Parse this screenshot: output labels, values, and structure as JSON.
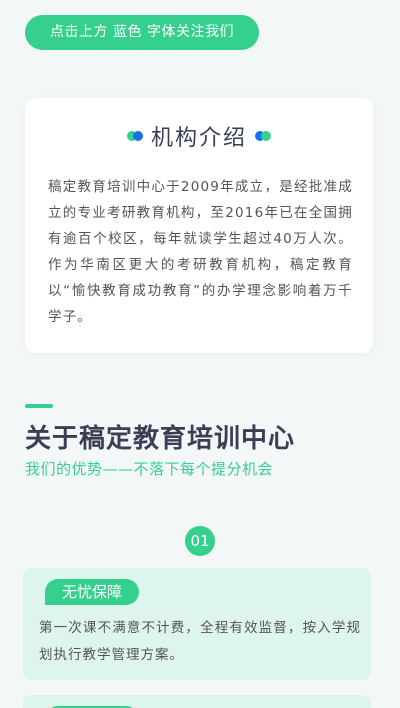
{
  "banner": {
    "follow_text": "点击上方 蓝色 字体关注我们"
  },
  "intro": {
    "title": "机构介绍",
    "body": "稿定教育培训中心于2009年成立，是经批准成立的专业考研教育机构，至2016年已在全国拥有逾百个校区，每年就读学生超过40万人次。作为华南区更大的考研教育机构，稿定教育以“愉快教育成功教育”的办学理念影响着万千学子。"
  },
  "about": {
    "title": "关于稿定教育培训中心",
    "subtitle": "我们的优势——不落下每个提分机会"
  },
  "advantages": [
    {
      "number": "01",
      "tag": "无忧保障",
      "text": "第一次课不满意不计费，全程有效监督，按入学规划执行教学管理方案。"
    }
  ],
  "colors": {
    "accent": "#36d08e",
    "blue": "#1b6fe8",
    "title": "#3a3f55"
  }
}
